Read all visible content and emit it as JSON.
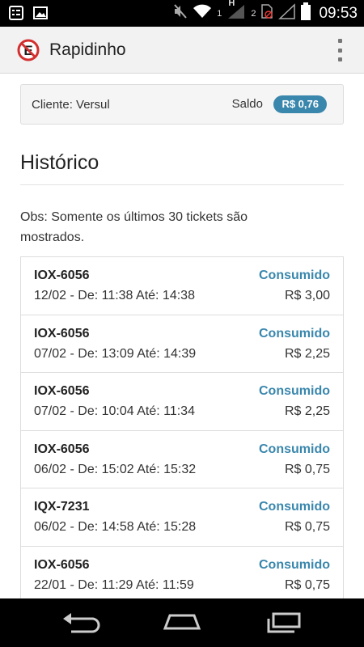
{
  "status_bar": {
    "time": "09:53",
    "sim1": "1",
    "network": "H",
    "sim2": "2"
  },
  "action_bar": {
    "title": "Rapidinho"
  },
  "client": {
    "label": "Cliente: Versul",
    "saldo_label": "Saldo",
    "saldo_value": "R$ 0,76"
  },
  "history": {
    "title": "Histórico",
    "note": "Obs: Somente os últimos 30 tickets são mostrados.",
    "tickets": [
      {
        "plate": "IOX-6056",
        "period": "12/02 - De: 11:38 Até: 14:38",
        "status": "Consumido",
        "price": "R$ 3,00"
      },
      {
        "plate": "IOX-6056",
        "period": "07/02 - De: 13:09 Até: 14:39",
        "status": "Consumido",
        "price": "R$ 2,25"
      },
      {
        "plate": "IOX-6056",
        "period": "07/02 - De: 10:04 Até: 11:34",
        "status": "Consumido",
        "price": "R$ 2,25"
      },
      {
        "plate": "IOX-6056",
        "period": "06/02 - De: 15:02 Até: 15:32",
        "status": "Consumido",
        "price": "R$ 0,75"
      },
      {
        "plate": "IQX-7231",
        "period": "06/02 - De: 14:58 Até: 15:28",
        "status": "Consumido",
        "price": "R$ 0,75"
      },
      {
        "plate": "IOX-6056",
        "period": "22/01 - De: 11:29 Até: 11:59",
        "status": "Consumido",
        "price": "R$ 0,75"
      }
    ]
  },
  "colors": {
    "accent": "#3a87ad",
    "logo_red": "#d32f2f"
  },
  "icons": {
    "statusbar_left": [
      "notification-icon",
      "image-icon"
    ],
    "statusbar_right": [
      "mute-icon",
      "wifi-icon",
      "signal-icon",
      "no-sim-icon",
      "battery-icon"
    ],
    "navbar": [
      "back-icon",
      "home-icon",
      "recent-apps-icon"
    ]
  }
}
